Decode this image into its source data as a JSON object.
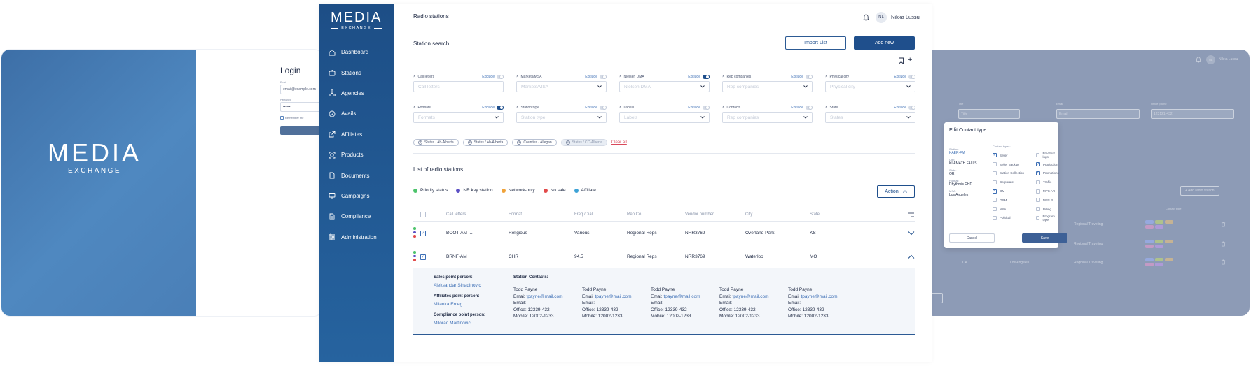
{
  "brand": {
    "name": "MEDIA",
    "sub": "EXCHANGE"
  },
  "colors": {
    "primary": "#1f4f8c",
    "link": "#3d6fb5",
    "danger": "#d9485a"
  },
  "login": {
    "title": "Login",
    "email_label": "Email",
    "email_value": "email@example.com",
    "password_label": "Password",
    "password_value": "••••••",
    "remember_label": "Remember me"
  },
  "sidebar": {
    "items": [
      {
        "label": "Dashboard",
        "icon": "home-icon"
      },
      {
        "label": "Stations",
        "icon": "radio-icon"
      },
      {
        "label": "Agencies",
        "icon": "network-icon"
      },
      {
        "label": "Avails",
        "icon": "check-circle-icon"
      },
      {
        "label": "Affiliates",
        "icon": "share-icon"
      },
      {
        "label": "Products",
        "icon": "target-icon"
      },
      {
        "label": "Documents",
        "icon": "document-icon"
      },
      {
        "label": "Campaigns",
        "icon": "monitor-icon"
      },
      {
        "label": "Compliance",
        "icon": "shield-doc-icon"
      },
      {
        "label": "Administration",
        "icon": "sliders-icon"
      }
    ]
  },
  "header": {
    "title": "Radio stations",
    "avatar_initials": "NL",
    "user_name": "Nikka Lussu"
  },
  "search": {
    "title": "Station search",
    "import_label": "Import List",
    "add_label": "Add new",
    "exclude_label": "Exclude",
    "filters": [
      {
        "label": "Call letters",
        "placeholder": "Call letters",
        "on": false,
        "dropdown": false
      },
      {
        "label": "Markets/MSA",
        "placeholder": "Markets/MSA",
        "on": false,
        "dropdown": true
      },
      {
        "label": "Nielsen DMA",
        "placeholder": "Nielsen DMA",
        "on": true,
        "dropdown": true
      },
      {
        "label": "Rep companies",
        "placeholder": "Rep companies",
        "on": false,
        "dropdown": true
      },
      {
        "label": "Physical city",
        "placeholder": "Physical city",
        "on": false,
        "dropdown": true
      },
      {
        "label": "Formats",
        "placeholder": "Formats",
        "on": true,
        "dropdown": true
      },
      {
        "label": "Station type",
        "placeholder": "Station type",
        "on": false,
        "dropdown": true
      },
      {
        "label": "Labels",
        "placeholder": "Labels",
        "on": false,
        "dropdown": true
      },
      {
        "label": "Contacts",
        "placeholder": "Rep companies",
        "on": false,
        "dropdown": true
      },
      {
        "label": "State",
        "placeholder": "States",
        "on": false,
        "dropdown": true
      }
    ],
    "chips": [
      "States / Ab-Alberta",
      "States / Ab-Alberta",
      "Counties / Allegan",
      "States / CC-Alberta"
    ],
    "clear_all": "Clear all"
  },
  "list": {
    "title": "List of radio stations",
    "legend": [
      {
        "label": "Priority status",
        "color": "#4cc36b"
      },
      {
        "label": "NR key station",
        "color": "#5b4fc4"
      },
      {
        "label": "Network-only",
        "color": "#f0a33a"
      },
      {
        "label": "No sale",
        "color": "#e24a4a"
      },
      {
        "label": "Affiliate",
        "color": "#3da2d6"
      }
    ],
    "action_label": "Action",
    "columns": [
      "Call letters",
      "Format",
      "Freq./Dial",
      "Rep Co.",
      "Vendor number",
      "City",
      "State"
    ],
    "rows": [
      {
        "call": "BOOT-AM",
        "format": "Religious",
        "freq": "Various",
        "rep": "Regional Reps",
        "vendor": "NRR3769",
        "city": "Overland Park",
        "state": "KS"
      },
      {
        "call": "BRNF-AM",
        "format": "CHR",
        "freq": "94.5",
        "rep": "Regional Reps",
        "vendor": "NRR3769",
        "city": "Waterloo",
        "state": "MO"
      }
    ],
    "detail": {
      "sales_h": "Sales point person:",
      "sales_v": "Aleksandar Sinadinovic",
      "aff_h": "Affiliates point person:",
      "aff_v": "Milanka Erceg",
      "comp_h": "Compliance point person:",
      "comp_v": "Milorad Martinovic",
      "contacts_h": "Station Contacts:",
      "contacts": [
        {
          "name": "Todd Payne",
          "email": "tpayne@mail.com",
          "email2": "Email:",
          "office": "Office: 12339-432",
          "mobile": "Mobile: 12002-1233"
        },
        {
          "name": "Todd Payne",
          "email": "tpayne@mail.com",
          "email2": "Email:",
          "office": "Office: 12339-432",
          "mobile": "Mobile: 12002-1233"
        },
        {
          "name": "Todd Payne",
          "email": "tpayne@mail.com",
          "email2": "Email:",
          "office": "Office: 12339-432",
          "mobile": "Mobile: 12002-1233"
        },
        {
          "name": "Todd Payne",
          "email": "tpayne@mail.com",
          "email2": "Email:",
          "office": "Office: 12339-432",
          "mobile": "Mobile: 12002-1233"
        },
        {
          "name": "Todd Payne",
          "email": "tpayne@mail.com",
          "email2": "Email:",
          "office": "Office: 12339-432",
          "mobile": "Mobile: 12002-1233"
        }
      ],
      "email_prefix": "Emai:"
    }
  },
  "right": {
    "user_initials": "NL",
    "user_name": "Nikka Lussu",
    "title_label": "Title",
    "title_value": "Title",
    "email_label": "Email",
    "email_value": "Email",
    "office_label": "Office phone",
    "office_value": "123121-432",
    "add_label": "+ Add radio station",
    "contact_type_col": "Contact type",
    "bg_rows": [
      "Regional Traveling",
      "Regional Traveling",
      "Regional Traveling"
    ],
    "bg_state": "CA",
    "bg_city": "Los Angeles"
  },
  "modal": {
    "title": "Edit Contact type",
    "station_l": "Station:",
    "station_v": "KAER-FM",
    "city_l": "City:",
    "city_v": "KLAMATH FALLS",
    "state_l": "State:",
    "state_v": "OR",
    "format_l": "Format:",
    "format_v": "Rhythmic CHR",
    "msa_l": "MSA:",
    "msa_v": "Los Angeles",
    "types_h": "Contact types:",
    "col1": [
      {
        "label": "Seller",
        "on": true
      },
      {
        "label": "Seller Backup",
        "on": false
      },
      {
        "label": "Station Collection",
        "on": false
      },
      {
        "label": "Corporate",
        "on": false
      },
      {
        "label": "GM",
        "on": true
      },
      {
        "label": "GSM",
        "on": false
      },
      {
        "label": "NSA",
        "on": false
      },
      {
        "label": "Political",
        "on": false
      }
    ],
    "col2": [
      {
        "label": "Pre/Post logs",
        "on": false
      },
      {
        "label": "Production",
        "on": true
      },
      {
        "label": "Promotions",
        "on": true
      },
      {
        "label": "Traffic",
        "on": false
      },
      {
        "label": "MPS AR",
        "on": false
      },
      {
        "label": "MPS PL",
        "on": false
      },
      {
        "label": "Billing",
        "on": false
      },
      {
        "label": "Program type",
        "on": false
      }
    ],
    "cancel": "Cancel",
    "save": "Save"
  }
}
